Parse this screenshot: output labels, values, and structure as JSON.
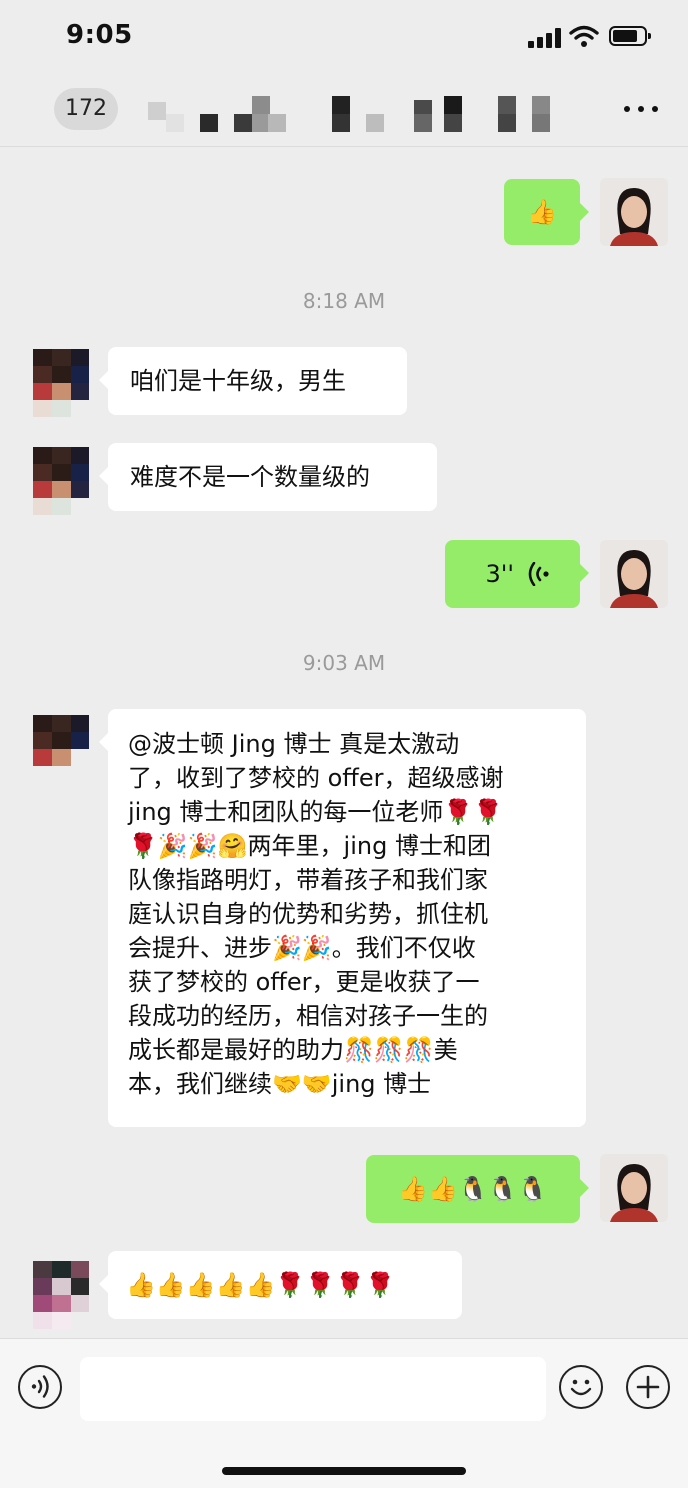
{
  "status_bar": {
    "time": "9:05"
  },
  "header": {
    "back_count": "172",
    "title_obscured": true
  },
  "messages": {
    "ts1": "8:18 AM",
    "ts2": "9:03 AM",
    "m_thumb": "👍",
    "m1": "咱们是十年级，男生",
    "m2": "难度不是一个数量级的",
    "voice_duration": "3''",
    "long_lines": [
      "@波士顿 Jing 博士 真是太激动",
      "了，收到了梦校的 offer，超级感谢",
      "jing 博士和团队的每一位老师🌹🌹",
      "🌹🎉🎉🤗两年里，jing 博士和团",
      "队像指路明灯，带着孩子和我们家",
      "庭认识自身的优势和劣势，抓住机",
      "会提升、进步🎉🎉。我们不仅收",
      "获了梦校的 offer，更是收获了一",
      "段成功的经历，相信对孩子一生的",
      "成长都是最好的助力🎊🎊🎊美",
      "本，我们继续🤝🤝jing 博士"
    ],
    "m_emoji_out": "👍👍🐧🐧🐧",
    "m_emoji_in": "👍👍👍👍👍🌹🌹🌹🌹"
  },
  "input_bar": {
    "voice_icon": "voice-icon",
    "emoji_icon": "emoji-icon",
    "plus_icon": "plus-icon"
  }
}
